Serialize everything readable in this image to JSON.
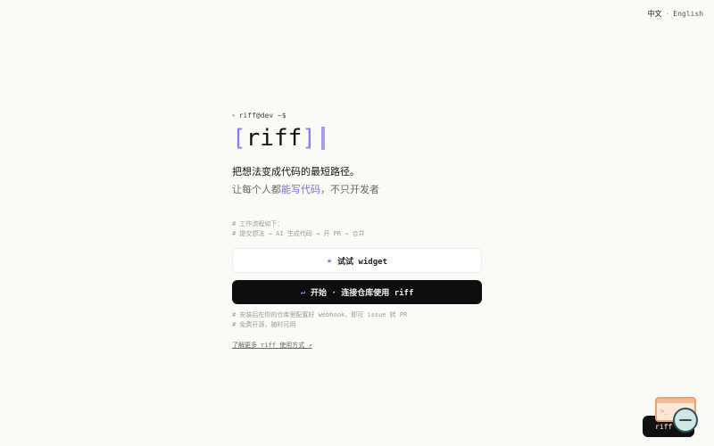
{
  "lang": {
    "current": "中文",
    "separator": "·",
    "other": "English"
  },
  "prompt": {
    "arrow": "▸",
    "text": "riff@dev ~$"
  },
  "logo": {
    "open": "[",
    "word": "riff",
    "close": "]"
  },
  "tagline": "把想法变成代码的最短路径。",
  "subtag": {
    "before": "让每个人都",
    "highlight": "能写代码",
    "after": "，不只开发者"
  },
  "comments": [
    "# 工作流程如下：",
    "# 提交想法 → AI 生成代码 → 开 PR → 合并"
  ],
  "widget_button": {
    "icon": "★",
    "label": "试试 widget"
  },
  "primary_button": {
    "icon": "↵",
    "label": "开始 · 连接仓库使用 riff"
  },
  "comments2": [
    "# 安装后在你的仓库里配置好 webhook，即可 issue 转 PR",
    "# 免费开源，随时可用"
  ],
  "footer_link": "了解更多 riff 使用方式 ↗",
  "corner": {
    "pill_label": "riff"
  }
}
